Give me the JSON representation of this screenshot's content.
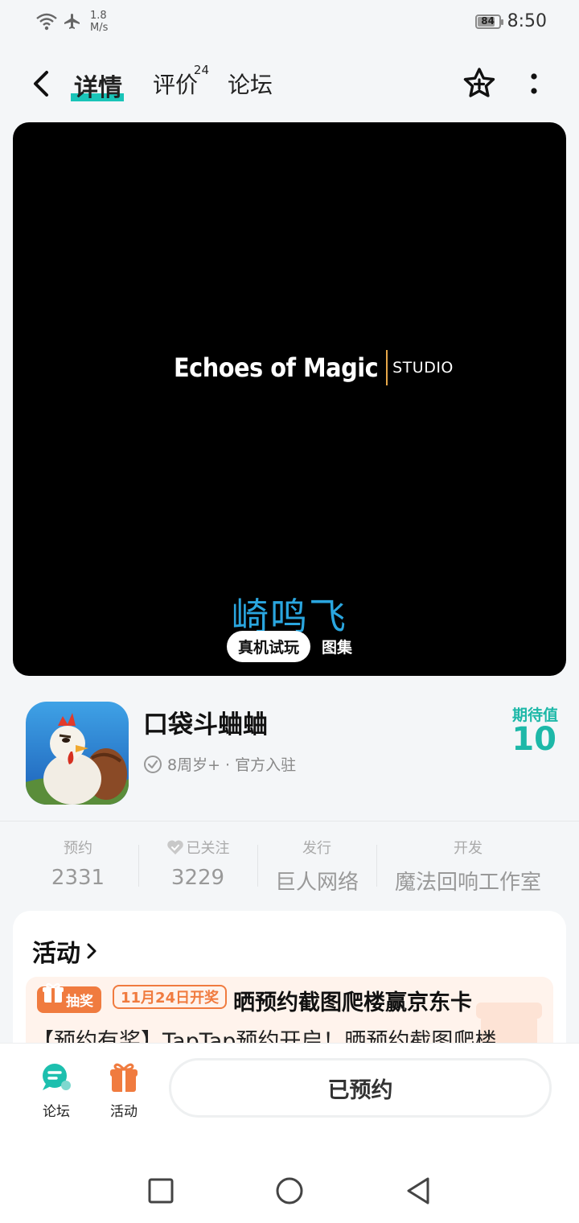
{
  "status_bar": {
    "speed_value": "1.8",
    "speed_unit": "M/s",
    "battery": "84",
    "battery_level": 0.84,
    "time": "8:50"
  },
  "nav": {
    "tabs": [
      {
        "label": "详情",
        "active": true
      },
      {
        "label": "评价",
        "badge": "24"
      },
      {
        "label": "论坛"
      }
    ]
  },
  "media": {
    "studio_logo_main": "Echoes of Magic",
    "studio_logo_sub": "STUDIO",
    "caption": "崎鸣飞",
    "tabs": [
      "真机试玩",
      "图集"
    ]
  },
  "game": {
    "title": "口袋斗蛐蛐",
    "meta": "8周岁+ · 官方入驻",
    "expectation_label": "期待值",
    "expectation_value": "10"
  },
  "stats": [
    {
      "label": "预约",
      "value": "2331"
    },
    {
      "label": "已关注",
      "value": "3229"
    },
    {
      "label": "发行",
      "value": "巨人网络"
    },
    {
      "label": "开发",
      "value": "魔法回响工作室"
    }
  ],
  "activity": {
    "section_title": "活动",
    "badge_type": "抽奖",
    "badge_date": "11月24日开奖",
    "title": "晒预约截图爬楼赢京东卡",
    "description": "【预约有奖】TapTap预约开启！晒预约截图爬楼"
  },
  "bottom_bar": {
    "forum_label": "论坛",
    "activity_label": "活动",
    "reserve_button": "已预约"
  },
  "colors": {
    "accent": "#19c4b8",
    "orange": "#f07b3f",
    "caption_blue": "#2aa6df"
  }
}
